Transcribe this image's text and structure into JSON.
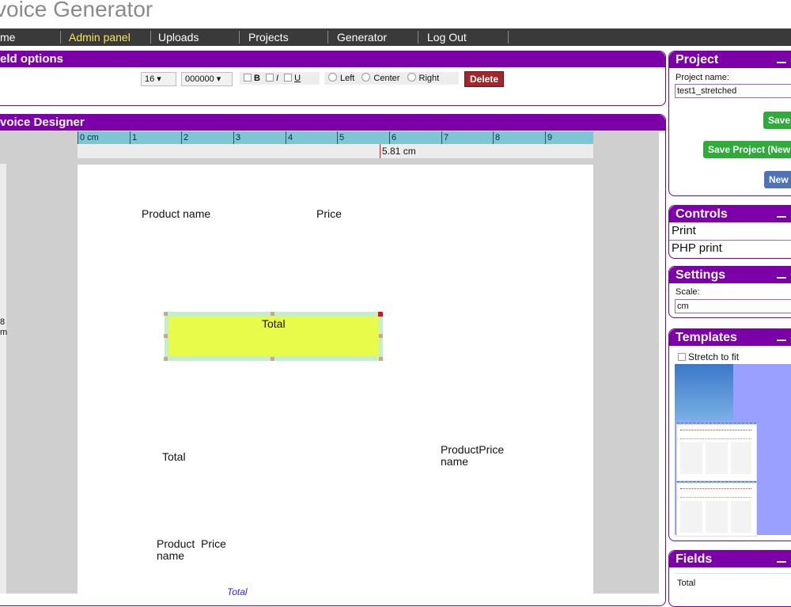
{
  "app": {
    "title": "voice Generator"
  },
  "nav": {
    "items": [
      {
        "label": "me"
      },
      {
        "label": "Admin panel",
        "active": true
      },
      {
        "label": "Uploads"
      },
      {
        "label": "Projects"
      },
      {
        "label": "Generator"
      },
      {
        "label": "Log Out"
      }
    ]
  },
  "field_options": {
    "title": "eld options",
    "font_size": "16",
    "color": "000000",
    "bold_label": "B",
    "italic_label": "I",
    "underline_label": "U",
    "align_left": "Left",
    "align_center": "Center",
    "align_right": "Right",
    "delete_label": "Delete"
  },
  "designer": {
    "title": "voice Designer",
    "ruler_ticks": [
      "0 cm",
      "1",
      "2",
      "3",
      "4",
      "5",
      "6",
      "7",
      "8",
      "9"
    ],
    "position_label": "5.81 cm",
    "left_ruler_label": "8\nm",
    "fields": [
      {
        "text": "Product name"
      },
      {
        "text": "Price"
      },
      {
        "text": "Total"
      },
      {
        "text": "ProductPrice\nname"
      },
      {
        "text": "Product  Price\nname"
      },
      {
        "text": "Total"
      }
    ],
    "selected_field": "Total"
  },
  "project": {
    "title": "Project",
    "name_label": "Project name:",
    "name_value": "test1_stretched",
    "save_label": "Save",
    "save_new_label": "Save Project (New",
    "new_label": "New"
  },
  "controls": {
    "title": "Controls",
    "items": [
      "Print",
      "PHP print"
    ]
  },
  "settings": {
    "title": "Settings",
    "scale_label": "Scale:",
    "scale_value": "cm"
  },
  "templates": {
    "title": "Templates",
    "stretch_label": "Stretch to fit"
  },
  "fields_panel": {
    "title": "Fields",
    "items": [
      "Total"
    ]
  }
}
